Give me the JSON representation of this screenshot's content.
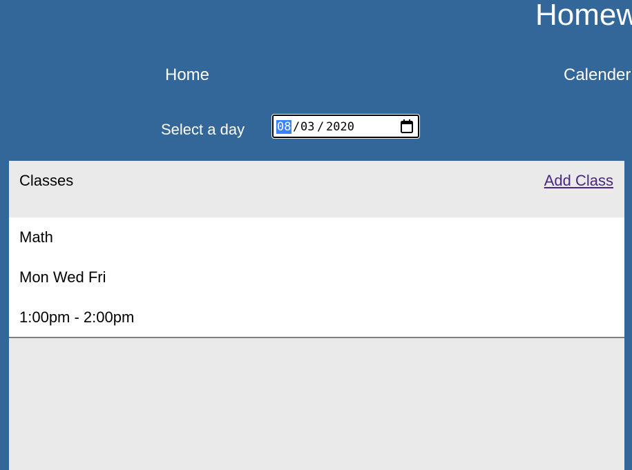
{
  "header": {
    "title": "Homew",
    "nav": {
      "home": "Home",
      "calendar": "Calender"
    }
  },
  "day_picker": {
    "label": "Select a day",
    "month": "08",
    "day": "03",
    "year": "2020",
    "separator": "/",
    "icon": "calendar-icon"
  },
  "classes_panel": {
    "title": "Classes",
    "add_link": "Add Class",
    "items": [
      {
        "name": "Math",
        "days": "Mon Wed Fri",
        "time": "1:00pm - 2:00pm"
      }
    ]
  },
  "colors": {
    "header_bg": "#336699",
    "panel_bg": "#eaeaea",
    "card_bg": "#ffffff",
    "link": "#4b2680",
    "highlight": "#3b82f6"
  }
}
